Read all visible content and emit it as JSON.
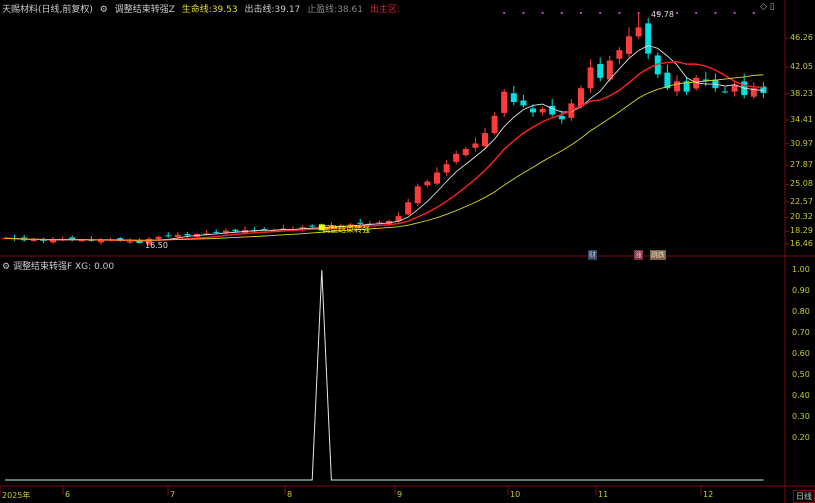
{
  "header": {
    "stock": "天赐材料(日线,前复权)",
    "indicator": "调整结束转强Z",
    "life_line_label": "生命线:",
    "life_line": "39.53",
    "exit_line_label": "出击线:",
    "exit_line": "39.17",
    "stop_line_label": "止盈线:",
    "stop_line": "38.61",
    "zone_label": "出主区:"
  },
  "sub_header": {
    "indicator": "调整结束转强F",
    "xg_label": "XG:",
    "xg_value": "0.00"
  },
  "price_axis": [
    "46.26",
    "42.05",
    "38.23",
    "34.41",
    "30.97",
    "27.87",
    "25.08",
    "22.57",
    "20.32",
    "18.29",
    "16.46"
  ],
  "indicator_axis": [
    "1.00",
    "0.90",
    "0.80",
    "0.70",
    "0.60",
    "0.50",
    "0.40",
    "0.30",
    "0.20"
  ],
  "date_axis": [
    "2025年",
    "6",
    "7",
    "8",
    "9",
    "10",
    "11",
    "12"
  ],
  "period_button": "日线",
  "annotations": {
    "high": "49.78",
    "low": "16.50",
    "signal": "调整结束转强",
    "tag1": "财",
    "tag2": "涨",
    "tag3": "跳跌"
  },
  "colors": {
    "up": "#ff3c3c",
    "down": "#00e0e0",
    "ma_fast": "#e0e0e0",
    "ma_mid": "#ff2020",
    "ma_slow": "#d8d820",
    "axis": "#7a0c10",
    "signal": "#ffff00"
  },
  "chart_data": [
    {
      "type": "candlestick",
      "close": [
        17.3,
        17.2,
        17.0,
        17.1,
        16.9,
        17.0,
        17.2,
        17.1,
        17.0,
        16.9,
        17.0,
        17.1,
        16.9,
        16.8,
        16.6,
        17.2,
        17.5,
        17.6,
        17.8,
        17.7,
        17.9,
        18.0,
        18.2,
        18.4,
        18.3,
        18.5,
        18.4,
        18.6,
        18.5,
        18.7,
        18.6,
        18.9,
        19.0,
        18.8,
        19.2,
        19.1,
        19.3,
        19.5,
        19.4,
        19.6,
        19.8,
        20.5,
        22.5,
        24.8,
        25.5,
        26.8,
        28.0,
        29.5,
        30.2,
        31.0,
        32.5,
        35.0,
        38.5,
        37.0,
        36.5,
        35.5,
        36.0,
        35.2,
        34.5,
        36.8,
        39.0,
        42.0,
        40.5,
        43.0,
        44.5,
        46.5,
        47.8,
        44.0,
        41.0,
        39.0,
        40.0,
        38.5,
        40.5,
        40.0,
        39.0,
        38.5,
        39.5,
        38.0,
        39.0,
        38.3
      ],
      "high_mark": 49.78,
      "low_mark": 16.5,
      "ylim": [
        16.46,
        46.26
      ]
    },
    {
      "type": "line",
      "name": "XG",
      "spike_index": 33,
      "ylim": [
        0,
        1
      ]
    }
  ]
}
